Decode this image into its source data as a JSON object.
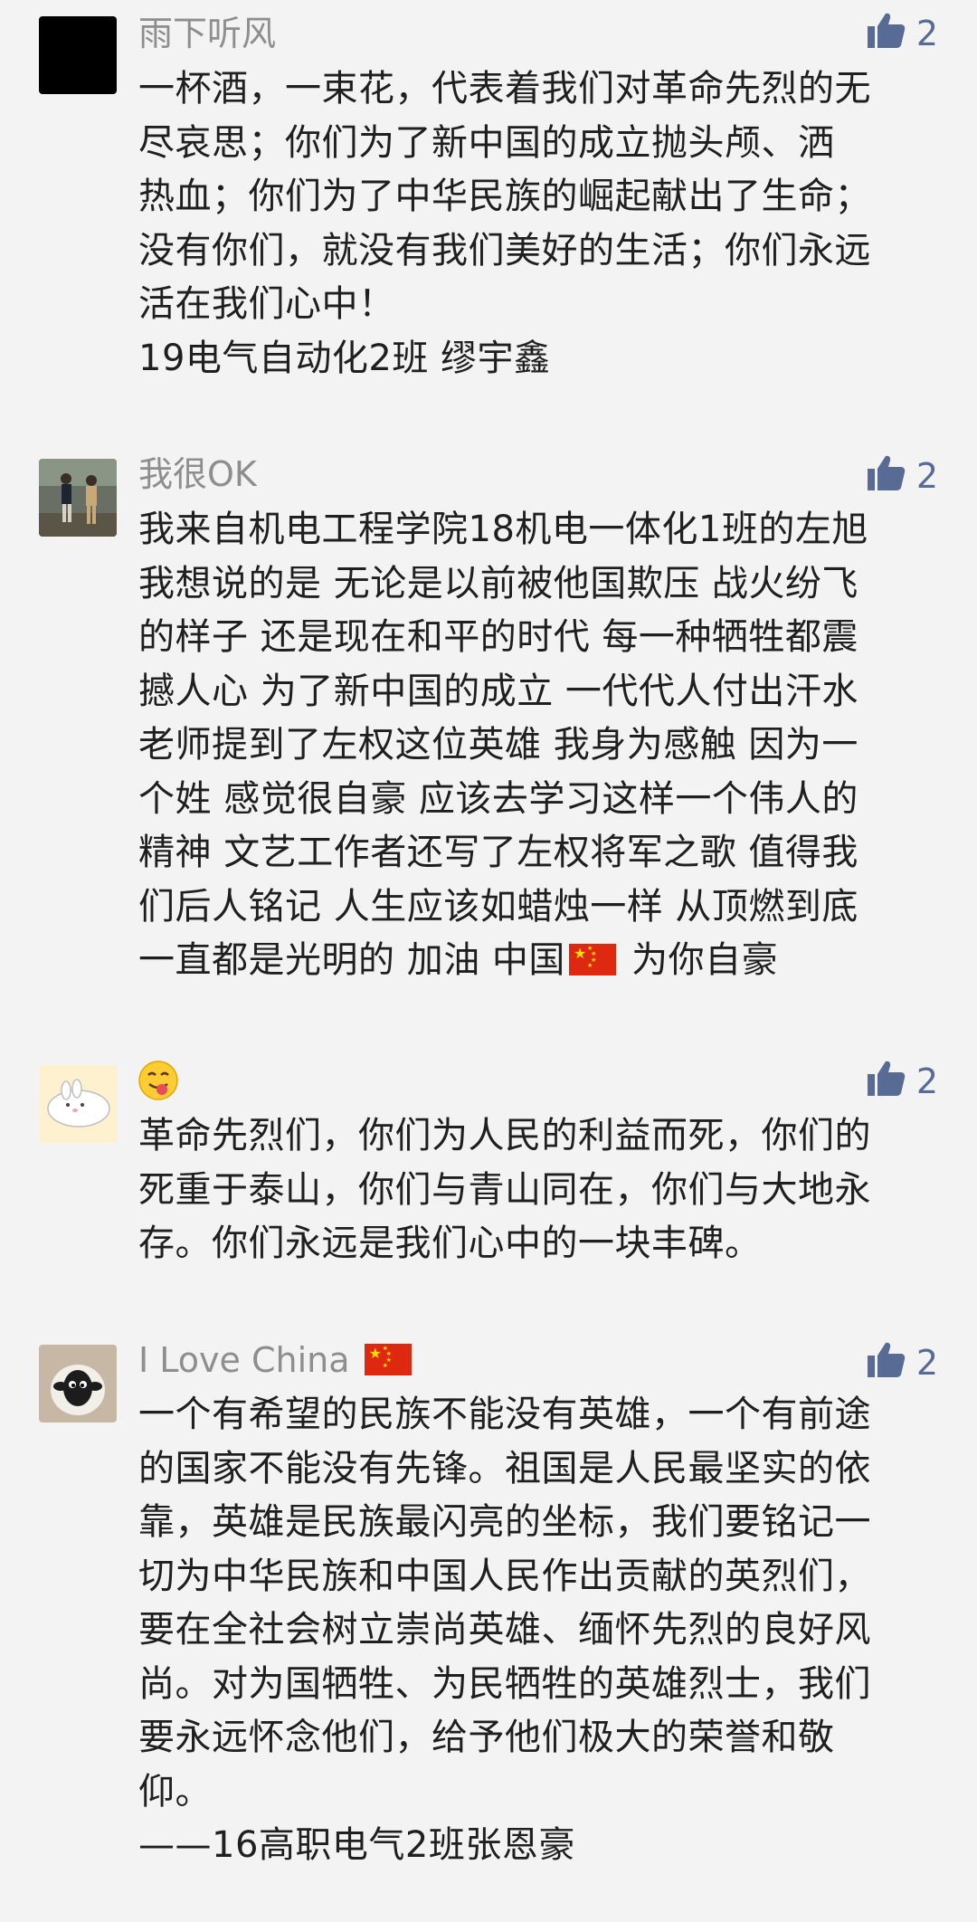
{
  "comments": [
    {
      "nickname": "雨下听风",
      "likes": "2",
      "content": "一杯酒，一束花，代表着我们对革命先烈的无\n尽哀思；你们为了新中国的成立抛头颅、洒\n热血；你们为了中华民族的崛起献出了生命；\n没有你们，就没有我们美好的生活；你们永远\n活在我们心中！\n19电气自动化2班 缪宇鑫"
    },
    {
      "nickname": "我很OK",
      "likes": "2",
      "content_part1": "我来自机电工程学院18机电一体化1班的左旭\n我想说的是 无论是以前被他国欺压 战火纷飞\n的样子 还是现在和平的时代 每一种牺牲都震\n撼人心 为了新中国的成立  一代代人付出汗水\n老师提到了左权这位英雄 我身为感触 因为一\n个姓 感觉很自豪 应该去学习这样一个伟人的\n精神  文艺工作者还写了左权将军之歌 值得我\n们后人铭记  人生应该如蜡烛一样 从顶燃到底\n一直都是光明的 加油 中国",
      "content_part2": " 为你自豪"
    },
    {
      "nickname_emoji": "yum-face-emoji",
      "likes": "2",
      "content": "革命先烈们，你们为人民的利益而死，你们的\n死重于泰山，你们与青山同在，你们与大地永\n存。你们永远是我们心中的一块丰碑。"
    },
    {
      "nickname": "I Love China",
      "likes": "2",
      "content": "一个有希望的民族不能没有英雄，一个有前途\n的国家不能没有先锋。祖国是人民最坚实的依\n靠，英雄是民族最闪亮的坐标，我们要铭记一\n切为中华民族和中国人民作出贡献的英烈们，\n要在全社会树立崇尚英雄、缅怀先烈的良好风\n尚。对为国牺牲、为民牺牲的英雄烈士，我们\n要永远怀念他们，给予他们极大的荣誉和敬\n仰。\n——16高职电气2班张恩豪"
    }
  ],
  "icons": {
    "like": "thumbs-up-icon",
    "flag": "china-flag-emoji"
  },
  "colors": {
    "accent": "#576b95",
    "nickname": "#8e8e8e",
    "text": "#1f1f1f",
    "background": "#f3f3f3"
  }
}
